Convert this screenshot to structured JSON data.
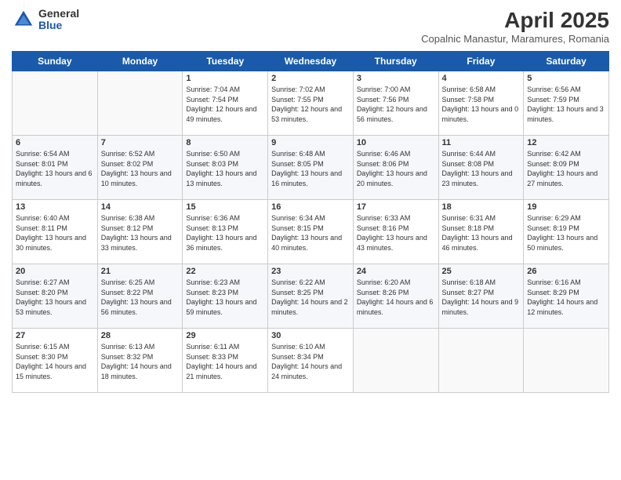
{
  "logo": {
    "general": "General",
    "blue": "Blue"
  },
  "title": "April 2025",
  "subtitle": "Copalnic Manastur, Maramures, Romania",
  "days_header": [
    "Sunday",
    "Monday",
    "Tuesday",
    "Wednesday",
    "Thursday",
    "Friday",
    "Saturday"
  ],
  "weeks": [
    [
      {
        "day": "",
        "info": ""
      },
      {
        "day": "",
        "info": ""
      },
      {
        "day": "1",
        "info": "Sunrise: 7:04 AM\nSunset: 7:54 PM\nDaylight: 12 hours\nand 49 minutes."
      },
      {
        "day": "2",
        "info": "Sunrise: 7:02 AM\nSunset: 7:55 PM\nDaylight: 12 hours\nand 53 minutes."
      },
      {
        "day": "3",
        "info": "Sunrise: 7:00 AM\nSunset: 7:56 PM\nDaylight: 12 hours\nand 56 minutes."
      },
      {
        "day": "4",
        "info": "Sunrise: 6:58 AM\nSunset: 7:58 PM\nDaylight: 13 hours\nand 0 minutes."
      },
      {
        "day": "5",
        "info": "Sunrise: 6:56 AM\nSunset: 7:59 PM\nDaylight: 13 hours\nand 3 minutes."
      }
    ],
    [
      {
        "day": "6",
        "info": "Sunrise: 6:54 AM\nSunset: 8:01 PM\nDaylight: 13 hours\nand 6 minutes."
      },
      {
        "day": "7",
        "info": "Sunrise: 6:52 AM\nSunset: 8:02 PM\nDaylight: 13 hours\nand 10 minutes."
      },
      {
        "day": "8",
        "info": "Sunrise: 6:50 AM\nSunset: 8:03 PM\nDaylight: 13 hours\nand 13 minutes."
      },
      {
        "day": "9",
        "info": "Sunrise: 6:48 AM\nSunset: 8:05 PM\nDaylight: 13 hours\nand 16 minutes."
      },
      {
        "day": "10",
        "info": "Sunrise: 6:46 AM\nSunset: 8:06 PM\nDaylight: 13 hours\nand 20 minutes."
      },
      {
        "day": "11",
        "info": "Sunrise: 6:44 AM\nSunset: 8:08 PM\nDaylight: 13 hours\nand 23 minutes."
      },
      {
        "day": "12",
        "info": "Sunrise: 6:42 AM\nSunset: 8:09 PM\nDaylight: 13 hours\nand 27 minutes."
      }
    ],
    [
      {
        "day": "13",
        "info": "Sunrise: 6:40 AM\nSunset: 8:11 PM\nDaylight: 13 hours\nand 30 minutes."
      },
      {
        "day": "14",
        "info": "Sunrise: 6:38 AM\nSunset: 8:12 PM\nDaylight: 13 hours\nand 33 minutes."
      },
      {
        "day": "15",
        "info": "Sunrise: 6:36 AM\nSunset: 8:13 PM\nDaylight: 13 hours\nand 36 minutes."
      },
      {
        "day": "16",
        "info": "Sunrise: 6:34 AM\nSunset: 8:15 PM\nDaylight: 13 hours\nand 40 minutes."
      },
      {
        "day": "17",
        "info": "Sunrise: 6:33 AM\nSunset: 8:16 PM\nDaylight: 13 hours\nand 43 minutes."
      },
      {
        "day": "18",
        "info": "Sunrise: 6:31 AM\nSunset: 8:18 PM\nDaylight: 13 hours\nand 46 minutes."
      },
      {
        "day": "19",
        "info": "Sunrise: 6:29 AM\nSunset: 8:19 PM\nDaylight: 13 hours\nand 50 minutes."
      }
    ],
    [
      {
        "day": "20",
        "info": "Sunrise: 6:27 AM\nSunset: 8:20 PM\nDaylight: 13 hours\nand 53 minutes."
      },
      {
        "day": "21",
        "info": "Sunrise: 6:25 AM\nSunset: 8:22 PM\nDaylight: 13 hours\nand 56 minutes."
      },
      {
        "day": "22",
        "info": "Sunrise: 6:23 AM\nSunset: 8:23 PM\nDaylight: 13 hours\nand 59 minutes."
      },
      {
        "day": "23",
        "info": "Sunrise: 6:22 AM\nSunset: 8:25 PM\nDaylight: 14 hours\nand 2 minutes."
      },
      {
        "day": "24",
        "info": "Sunrise: 6:20 AM\nSunset: 8:26 PM\nDaylight: 14 hours\nand 6 minutes."
      },
      {
        "day": "25",
        "info": "Sunrise: 6:18 AM\nSunset: 8:27 PM\nDaylight: 14 hours\nand 9 minutes."
      },
      {
        "day": "26",
        "info": "Sunrise: 6:16 AM\nSunset: 8:29 PM\nDaylight: 14 hours\nand 12 minutes."
      }
    ],
    [
      {
        "day": "27",
        "info": "Sunrise: 6:15 AM\nSunset: 8:30 PM\nDaylight: 14 hours\nand 15 minutes."
      },
      {
        "day": "28",
        "info": "Sunrise: 6:13 AM\nSunset: 8:32 PM\nDaylight: 14 hours\nand 18 minutes."
      },
      {
        "day": "29",
        "info": "Sunrise: 6:11 AM\nSunset: 8:33 PM\nDaylight: 14 hours\nand 21 minutes."
      },
      {
        "day": "30",
        "info": "Sunrise: 6:10 AM\nSunset: 8:34 PM\nDaylight: 14 hours\nand 24 minutes."
      },
      {
        "day": "",
        "info": ""
      },
      {
        "day": "",
        "info": ""
      },
      {
        "day": "",
        "info": ""
      }
    ]
  ]
}
